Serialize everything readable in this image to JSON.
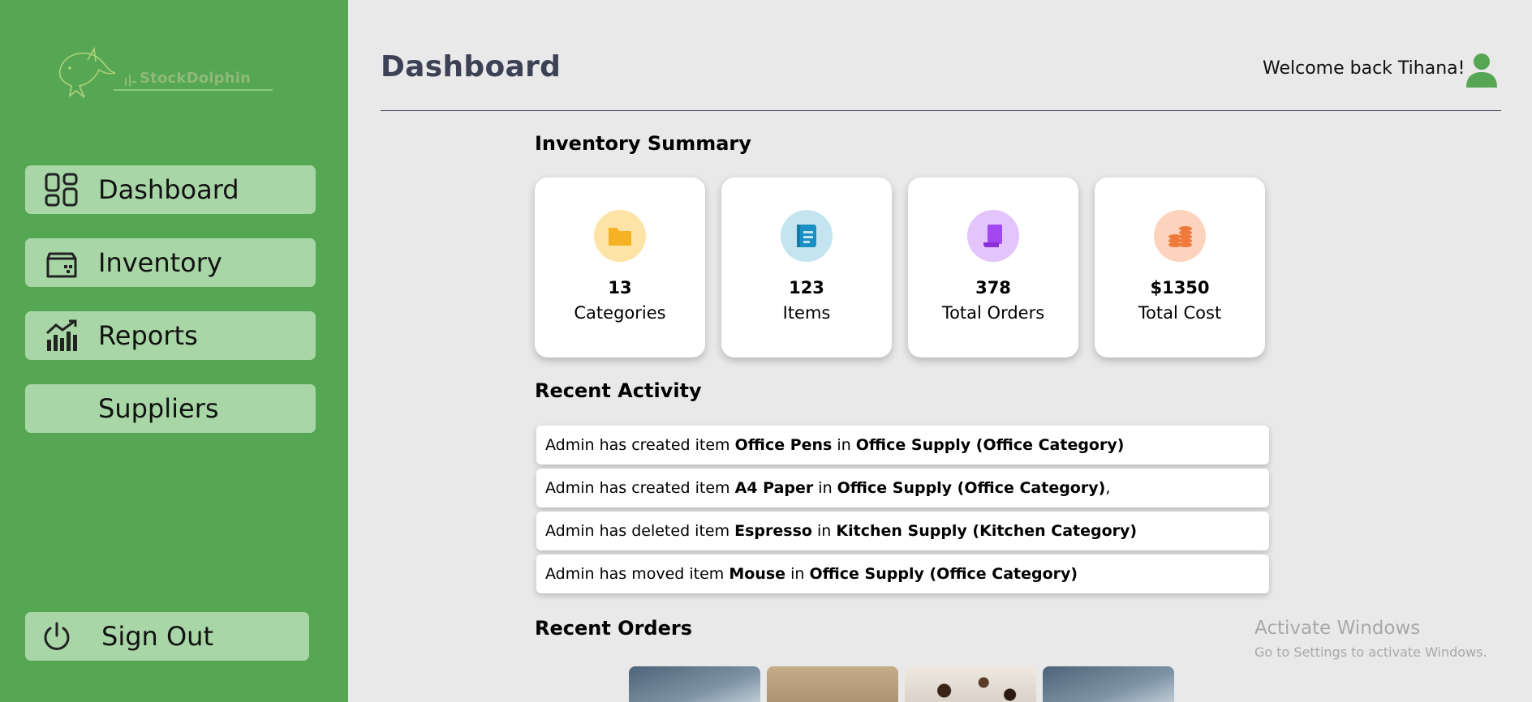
{
  "brand": {
    "name": "StockDolphin",
    "color": "#55a753"
  },
  "sidebar": {
    "items": [
      {
        "label": "Dashboard",
        "icon": "dashboard-grid-icon"
      },
      {
        "label": "Inventory",
        "icon": "inventory-box-icon"
      },
      {
        "label": "Reports",
        "icon": "reports-chart-icon"
      },
      {
        "label": "Suppliers",
        "icon": ""
      }
    ],
    "signout": {
      "label": "Sign Out",
      "icon": "power-icon"
    }
  },
  "header": {
    "title": "Dashboard",
    "welcome": "Welcome back Tihana!",
    "user_icon": "user-icon"
  },
  "inventory_summary": {
    "title": "Inventory Summary",
    "cards": [
      {
        "value": "13",
        "label": "Categories",
        "icon": "folder-icon",
        "icon_color": "#f5b323",
        "bg_color": "#fde3a5"
      },
      {
        "value": "123",
        "label": "Items",
        "icon": "document-icon",
        "icon_color": "#1a8fc4",
        "bg_color": "#c4e5ef"
      },
      {
        "value": "378",
        "label": "Total Orders",
        "icon": "scroll-icon",
        "icon_color": "#a347f0",
        "bg_color": "#e3c4fb"
      },
      {
        "value": "$1350",
        "label": "Total Cost",
        "icon": "coins-icon",
        "icon_color": "#f07a3c",
        "bg_color": "#fdd3bd"
      }
    ]
  },
  "recent_activity": {
    "title": "Recent Activity",
    "items": [
      {
        "prefix": "Admin has created item ",
        "item": "Office Pens",
        "mid": " in ",
        "location": "Office Supply (Office Category)",
        "suffix": ""
      },
      {
        "prefix": "Admin has created item ",
        "item": "A4 Paper",
        "mid": " in ",
        "location": "Office Supply (Office Category)",
        "suffix": ","
      },
      {
        "prefix": "Admin has deleted item ",
        "item": "Espresso",
        "mid": " in ",
        "location": "Kitchen Supply (Kitchen Category)",
        "suffix": ""
      },
      {
        "prefix": "Admin has moved item ",
        "item": "Mouse",
        "mid": " in ",
        "location": "Office Supply (Office Category)",
        "suffix": ""
      }
    ]
  },
  "recent_orders": {
    "title": "Recent Orders"
  },
  "watermark": {
    "title": "Activate Windows",
    "subtitle": "Go to Settings to activate Windows."
  }
}
